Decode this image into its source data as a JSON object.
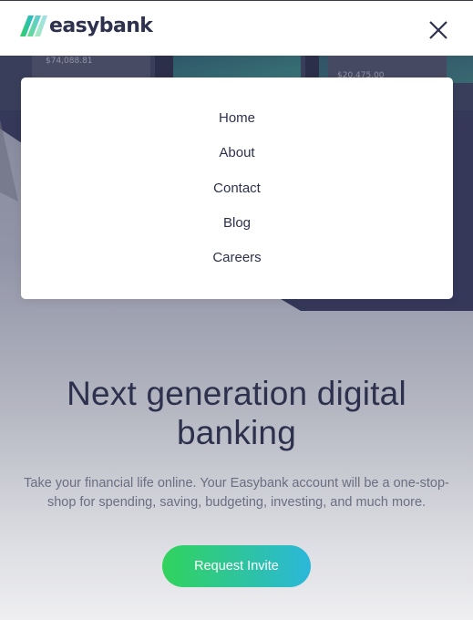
{
  "brand": {
    "name": "easybank",
    "logo_icon": "easybank-logo-icon"
  },
  "header": {
    "close_icon": "close-icon"
  },
  "menu": {
    "items": [
      {
        "label": "Home"
      },
      {
        "label": "About"
      },
      {
        "label": "Contact"
      },
      {
        "label": "Blog"
      },
      {
        "label": "Careers"
      }
    ]
  },
  "hero": {
    "mockup_values": [
      "$74,088.81",
      "$20,475.00"
    ],
    "title": "Next generation digital banking",
    "description": "Take your financial life online. Your Easybank account will be a one-stop-shop for spending, saving, budgeting, investing, and much more.",
    "cta_label": "Request Invite"
  },
  "colors": {
    "dark_blue": "#2d314d",
    "lime_green": "#31d35c",
    "bright_cyan": "#2bb7da",
    "grayish_blue": "#6b6e80"
  }
}
